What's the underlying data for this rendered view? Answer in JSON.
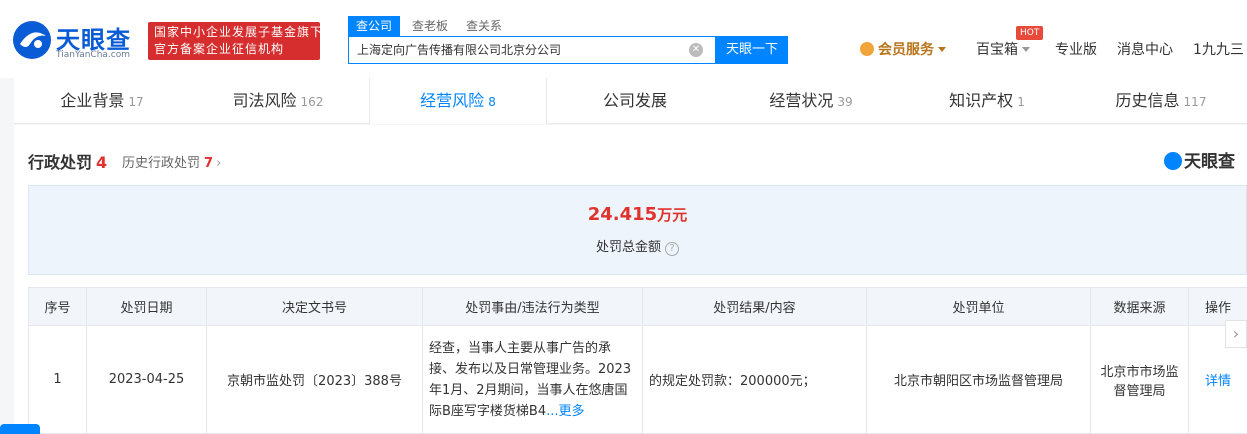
{
  "header": {
    "logo_text": "天眼查",
    "logo_sub": "TianYanCha.com",
    "slogan_line1": "国家中小企业发展子基金旗下",
    "slogan_line2": "官方备案企业征信机构",
    "search_tabs": [
      "查公司",
      "查老板",
      "查关系"
    ],
    "search_value": "上海定向广告传播有限公司北京分公司",
    "search_button": "天眼一下",
    "nav": {
      "member": "会员服务",
      "treasure": "百宝箱",
      "hot": "HOT",
      "pro": "专业版",
      "messages": "消息中心",
      "user": "1九九三"
    },
    "colors": {
      "brand": "#0084ff",
      "slogan_bg": "#d62e2e"
    }
  },
  "tabs": [
    {
      "label": "企业背景",
      "count": "17"
    },
    {
      "label": "司法风险",
      "count": "162"
    },
    {
      "label": "经营风险",
      "count": "8"
    },
    {
      "label": "公司发展",
      "count": ""
    },
    {
      "label": "经营状况",
      "count": "39"
    },
    {
      "label": "知识产权",
      "count": "1"
    },
    {
      "label": "历史信息",
      "count": "117"
    }
  ],
  "section": {
    "title": "行政处罚",
    "count": "4",
    "history_label": "历史行政处罚",
    "history_count": "7",
    "watermark": "天眼查"
  },
  "summary": {
    "amount": "24.415",
    "unit": "万元",
    "label": "处罚总金额"
  },
  "table": {
    "headers": [
      "序号",
      "处罚日期",
      "决定文书号",
      "处罚事由/违法行为类型",
      "处罚结果/内容",
      "处罚单位",
      "数据来源",
      "操作"
    ],
    "rows": [
      {
        "index": "1",
        "date": "2023-04-25",
        "doc_no": "京朝市监处罚〔2023〕388号",
        "reason": "经查，当事人主要从事广告的承接、发布以及日常管理业务。2023年1月、2月期间，当事人在悠唐国际B座写字楼货梯B4",
        "more": "...更多",
        "result": "的规定处罚款：200000元；",
        "unit": "北京市朝阳区市场监督管理局",
        "source": "北京市市场监督管理局",
        "action": "详情"
      }
    ]
  },
  "icons": [
    "logo-icon",
    "search-clear-icon",
    "crown-icon",
    "chevron-right-icon",
    "help-icon",
    "caret-down-icon"
  ]
}
